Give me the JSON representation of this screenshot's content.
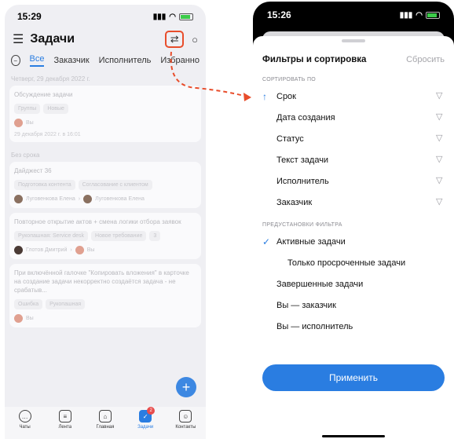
{
  "left": {
    "status": {
      "time": "15:29"
    },
    "header": {
      "title": "Задачи"
    },
    "tabs": [
      "Все",
      "Заказчик",
      "Исполнитель",
      "Избранно"
    ],
    "groups": [
      {
        "label": "Четверг, 29 декабря 2022 г.",
        "cards": [
          {
            "title": "Обсуждение задачи",
            "chips": [
              "Группы",
              "Новые"
            ],
            "people": [
              "Вы"
            ],
            "date": "29 декабря 2022 г. в 16:01"
          }
        ]
      },
      {
        "label": "Без срока",
        "cards": [
          {
            "title": "Дайджест 36",
            "chips": [
              "Подготовка контента",
              "Согласование с клиентом"
            ],
            "people": [
              "Луговенкова Елена",
              "Луговенкова Елена"
            ]
          },
          {
            "title": "Повторное открытие актов + смена логики отбора заявок",
            "chips": [
              "Рукопашная: Service desk",
              "Новое требование",
              "3"
            ],
            "people": [
              "Глотов Дмитрий",
              "Вы"
            ]
          },
          {
            "title": "При включённой галочке \"Копировать вложения\" в карточке на создание задачи некорректно создаётся задача - не срабатыв...",
            "chips": [
              "Ошибка",
              "Рукопашная"
            ],
            "people": [
              "Вы"
            ]
          }
        ]
      }
    ],
    "nav": [
      {
        "label": "Чаты",
        "icon": "chat-icon"
      },
      {
        "label": "Лента",
        "icon": "feed-icon"
      },
      {
        "label": "Главная",
        "icon": "home-icon"
      },
      {
        "label": "Задачи",
        "icon": "tasks-icon",
        "badge": "2"
      },
      {
        "label": "Контакты",
        "icon": "contacts-icon"
      }
    ]
  },
  "right": {
    "status": {
      "time": "15:26"
    },
    "sheet": {
      "title": "Фильтры и сортировка",
      "reset": "Сбросить",
      "sort_label": "СОРТИРОВАТЬ ПО",
      "sort_items": [
        "Срок",
        "Дата создания",
        "Статус",
        "Текст задачи",
        "Исполнитель",
        "Заказчик"
      ],
      "preset_label": "ПРЕДУСТАНОВКИ ФИЛЬТРА",
      "presets": [
        "Активные задачи",
        "Только просроченные задачи",
        "Завершенные задачи",
        "Вы — заказчик",
        "Вы — исполнитель"
      ],
      "apply": "Применить"
    }
  },
  "colors": {
    "accent": "#2a7de1",
    "highlight": "#e84d2b"
  }
}
